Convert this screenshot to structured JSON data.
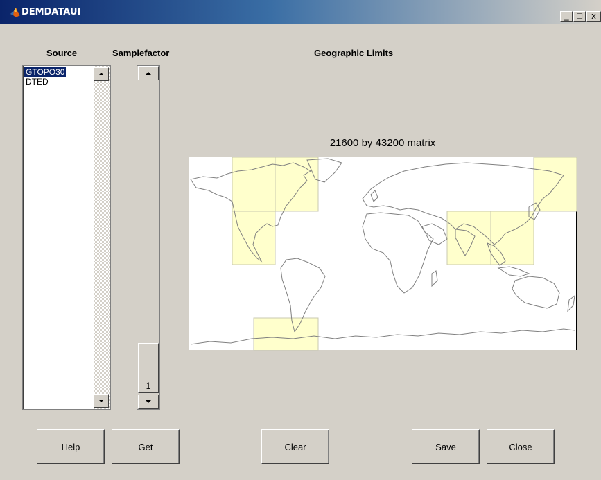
{
  "window": {
    "title": "DEMDATAUI",
    "controls": {
      "minimize": "_",
      "maximize": "□",
      "close": "x"
    }
  },
  "labels": {
    "source": "Source",
    "samplefactor": "Samplefactor",
    "geographic_limits": "Geographic Limits"
  },
  "source_list": {
    "items": [
      "GTOPO30",
      "DTED"
    ],
    "selected": "GTOPO30"
  },
  "samplefactor": {
    "value": "1"
  },
  "map": {
    "caption": "21600 by 43200 matrix",
    "tile_color": "#ffffcc",
    "tile_border": "#c8c8b0",
    "coast_color": "#808080"
  },
  "buttons": {
    "help": "Help",
    "get": "Get",
    "clear": "Clear",
    "save": "Save",
    "close": "Close"
  }
}
